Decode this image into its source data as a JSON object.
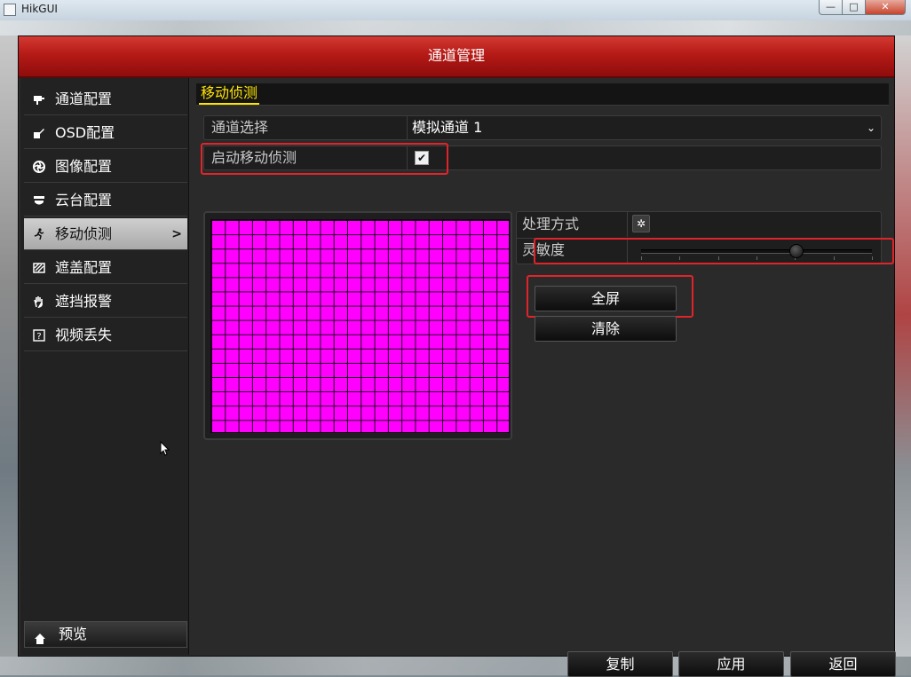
{
  "window": {
    "title": "HikGUI",
    "controls": {
      "minimize": "—",
      "maximize": "□",
      "close": "✕"
    }
  },
  "dialog": {
    "title": "通道管理"
  },
  "sidebar": {
    "items": [
      {
        "label": "通道配置",
        "icon": "camera-icon"
      },
      {
        "label": "OSD配置",
        "icon": "pen-icon"
      },
      {
        "label": "图像配置",
        "icon": "aperture-icon"
      },
      {
        "label": "云台配置",
        "icon": "ptz-icon"
      },
      {
        "label": "移动侦测",
        "icon": "runner-icon",
        "active": true,
        "arrow": ">"
      },
      {
        "label": "遮盖配置",
        "icon": "mask-icon"
      },
      {
        "label": "遮挡报警",
        "icon": "hand-icon"
      },
      {
        "label": "视频丢失",
        "icon": "question-icon"
      }
    ],
    "preview_label": "预览"
  },
  "main": {
    "tab_label": "移动侦测",
    "channel_select": {
      "label": "通道选择",
      "value": "模拟通道 1"
    },
    "enable_motion": {
      "label": "启动移动侦测",
      "checked": true,
      "mark": "✔"
    },
    "handling": {
      "label": "处理方式",
      "button_icon": "gear-icon"
    },
    "sensitivity": {
      "label": "灵敏度",
      "level": 0.67
    },
    "buttons": {
      "fullscreen": "全屏",
      "clear": "清除",
      "copy": "复制",
      "apply": "应用",
      "back": "返回"
    }
  },
  "colors": {
    "header_red": "#b51a16",
    "highlight_red": "#e0242a",
    "tab_yellow": "#ffe400",
    "grid_magenta": "#ff00ff"
  }
}
